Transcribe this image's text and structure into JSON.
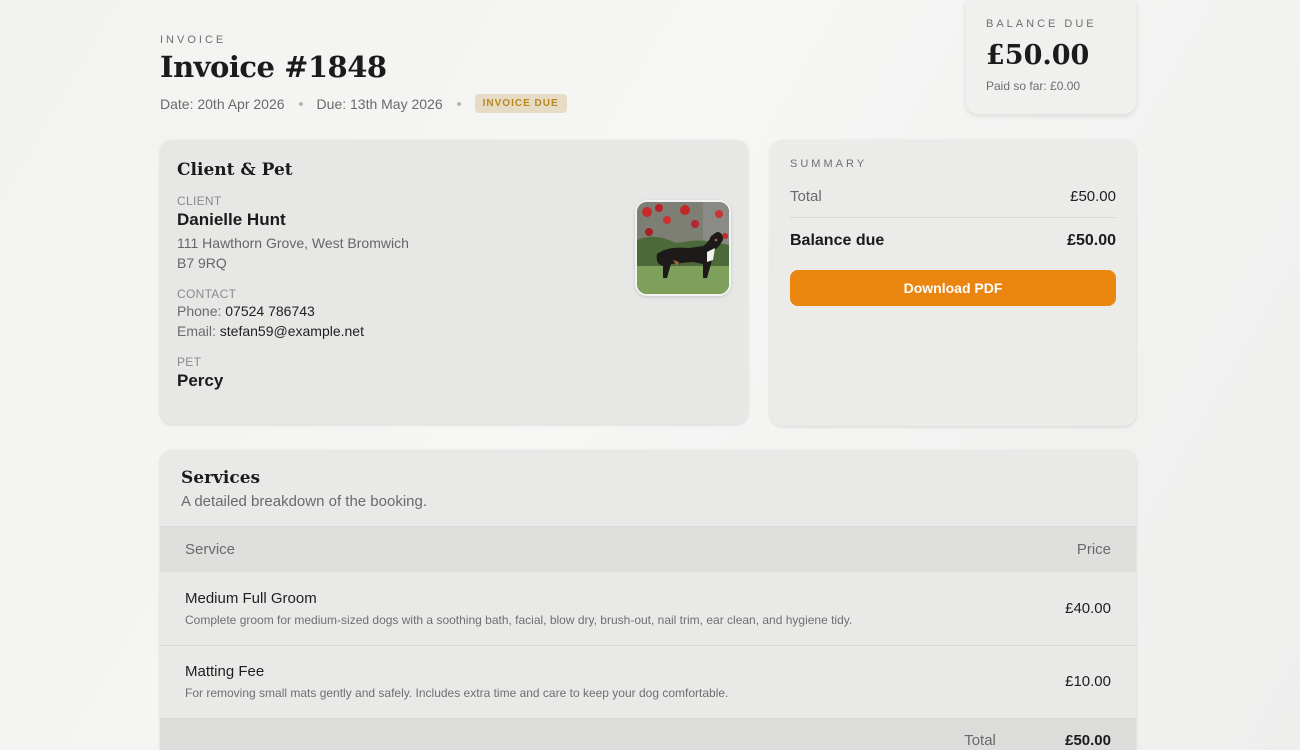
{
  "header": {
    "eyebrow": "INVOICE",
    "title": "Invoice #1848",
    "date": "Date: 20th Apr 2026",
    "due": "Due: 13th May 2026",
    "status_badge": "INVOICE DUE"
  },
  "balance_card": {
    "label": "BALANCE DUE",
    "amount": "£50.00",
    "paid_so_far": "Paid so far: £0.00"
  },
  "client_card": {
    "title": "Client & Pet",
    "client_label": "CLIENT",
    "client_name": "Danielle Hunt",
    "address_line1": "111 Hawthorn Grove, West Bromwich",
    "address_line2": "B7 9RQ",
    "contact_label": "CONTACT",
    "phone_label": "Phone:",
    "phone": "07524 786743",
    "email_label": "Email:",
    "email": "stefan59@example.net",
    "pet_label": "PET",
    "pet_name": "Percy"
  },
  "summary": {
    "label": "SUMMARY",
    "total_label": "Total",
    "total_value": "£50.00",
    "balance_label": "Balance due",
    "balance_value": "£50.00",
    "download_label": "Download PDF"
  },
  "services": {
    "title": "Services",
    "subtitle": "A detailed breakdown of the booking.",
    "col_service": "Service",
    "col_price": "Price",
    "items": [
      {
        "name": "Medium Full Groom",
        "description": "Complete groom for medium-sized dogs with a soothing bath, facial, blow dry, brush-out, nail trim, ear clean, and hygiene tidy.",
        "price": "£40.00"
      },
      {
        "name": "Matting Fee",
        "description": "For removing small mats gently and safely. Includes extra time and care to keep your dog comfortable.",
        "price": "£10.00"
      }
    ],
    "total_label": "Total",
    "total_value": "£50.00"
  },
  "colors": {
    "accent": "#ea850f",
    "badge_bg": "#e6dcc6",
    "badge_text": "#b9881f"
  }
}
